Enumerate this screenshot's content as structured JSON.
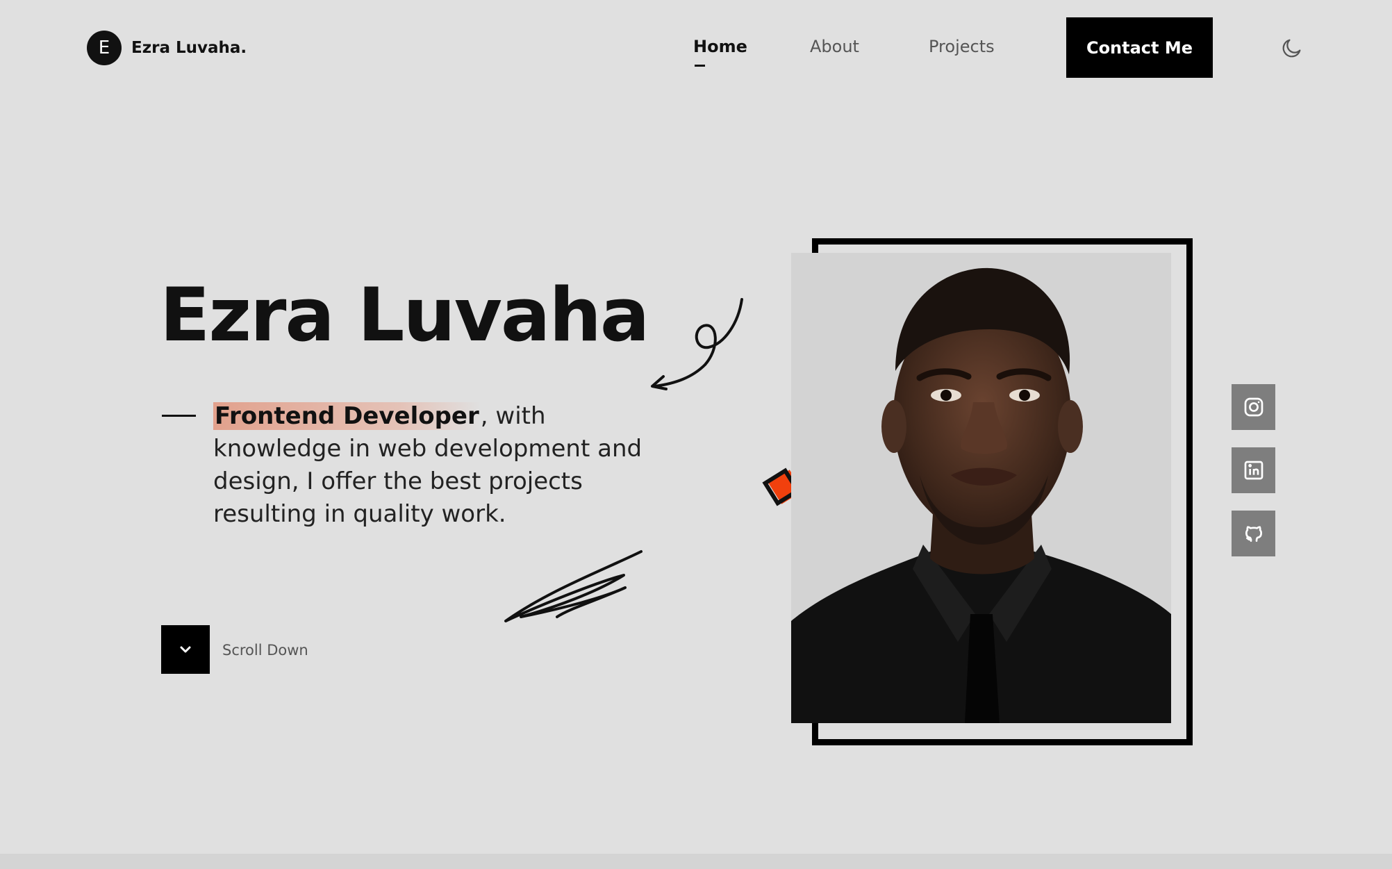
{
  "header": {
    "logo_initial": "E",
    "logo_text": "Ezra Luvaha.",
    "nav": [
      {
        "label": "Home",
        "active": true
      },
      {
        "label": "About",
        "active": false
      },
      {
        "label": "Projects",
        "active": false
      }
    ],
    "contact_label": "Contact Me",
    "theme_icon": "moon-icon"
  },
  "hero": {
    "name": "Ezra Luvaha",
    "role": "Frontend Developer",
    "description": ", with knowledge in web development and design, I offer the best projects resulting in quality work.",
    "scroll_label": "Scroll Down",
    "scroll_icon": "chevron-down-icon"
  },
  "socials": [
    {
      "name": "instagram",
      "icon": "instagram-icon"
    },
    {
      "name": "linkedin",
      "icon": "linkedin-icon"
    },
    {
      "name": "github",
      "icon": "github-icon"
    }
  ],
  "colors": {
    "background": "#e0e0e0",
    "text": "#111111",
    "accent": "#f1400d",
    "highlight": "#e2967e",
    "social_bg": "#7e7e7e"
  }
}
